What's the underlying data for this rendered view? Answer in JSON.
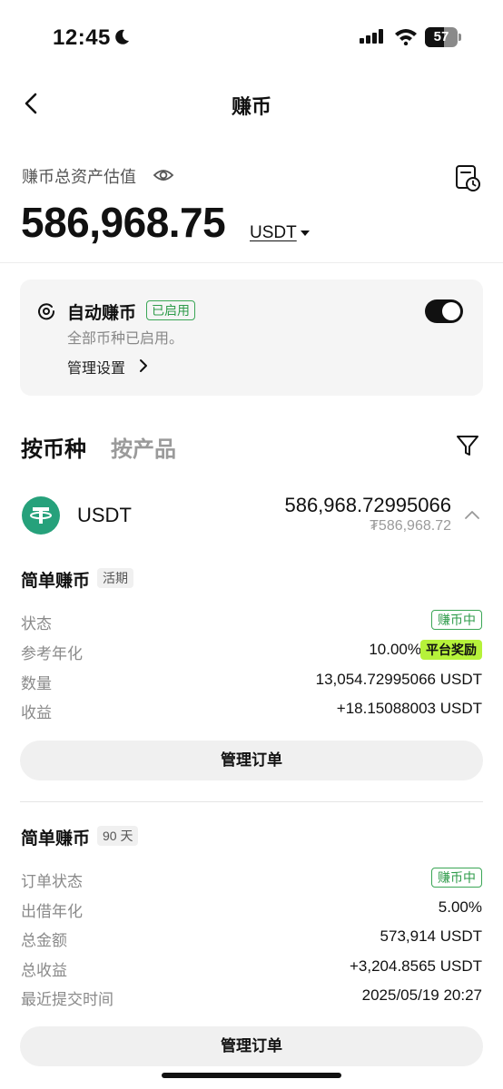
{
  "status_bar": {
    "time": "12:45",
    "battery": "57",
    "battery_level": 0.57
  },
  "nav": {
    "title": "赚币"
  },
  "summary": {
    "label": "赚币总资产估值",
    "value": "586,968.75",
    "unit": "USDT"
  },
  "auto_earn": {
    "title": "自动赚币",
    "badge": "已启用",
    "description": "全部币种已启用。",
    "manage": "管理设置",
    "enabled": true
  },
  "tabs": [
    {
      "label": "按币种",
      "active": true
    },
    {
      "label": "按产品",
      "active": false
    }
  ],
  "coin": {
    "name": "USDT",
    "amount": "586,968.72995066",
    "fiat": "₮586,968.72",
    "brand_color": "#26a17b"
  },
  "products": [
    {
      "title": "简单赚币",
      "tag": "活期",
      "rows": [
        {
          "label": "状态",
          "value": "赚币中"
        },
        {
          "label": "参考年化",
          "value": "10.00%",
          "extra": "平台奖励"
        },
        {
          "label": "数量",
          "value": "13,054.72995066 USDT"
        },
        {
          "label": "收益",
          "value": "+18.15088003 USDT"
        }
      ],
      "button": "管理订单"
    },
    {
      "title": "简单赚币",
      "tag": "90 天",
      "rows": [
        {
          "label": "订单状态",
          "value": "赚币中"
        },
        {
          "label": "出借年化",
          "value": "5.00%"
        },
        {
          "label": "总金额",
          "value": "573,914 USDT"
        },
        {
          "label": "总收益",
          "value": "+3,204.8565 USDT"
        },
        {
          "label": "最近提交时间",
          "value": "2025/05/19 20:27"
        }
      ],
      "button": "管理订单"
    }
  ],
  "colors": {
    "accent_green": "#2e9b4a",
    "reward_bg": "#b6f23a",
    "card_bg": "#f5f5f5"
  }
}
